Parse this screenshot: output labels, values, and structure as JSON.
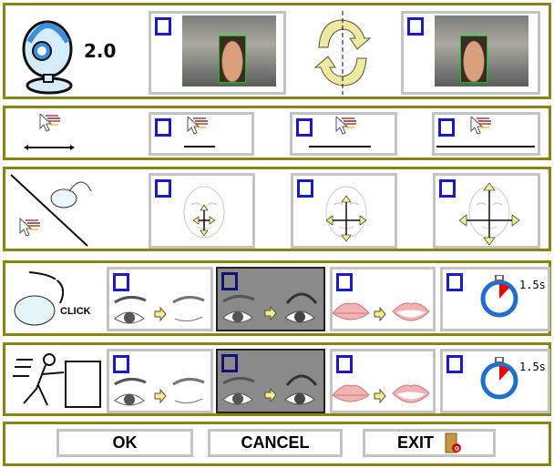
{
  "header": {
    "version": "2.0"
  },
  "camera_row": {
    "options": [
      {
        "name": "normal",
        "checked": false
      },
      {
        "name": "mirrored",
        "checked": false
      }
    ]
  },
  "speed_row": {
    "options": [
      {
        "name": "slow",
        "checked": false
      },
      {
        "name": "medium",
        "checked": false
      },
      {
        "name": "fast",
        "checked": false
      }
    ]
  },
  "movement_row": {
    "options": [
      {
        "name": "small",
        "checked": false
      },
      {
        "name": "medium",
        "checked": false
      },
      {
        "name": "large",
        "checked": false
      }
    ]
  },
  "click_row": {
    "label": "CLICK",
    "options": [
      {
        "name": "wink",
        "checked": false
      },
      {
        "name": "eyebrows",
        "checked": false,
        "selected": true
      },
      {
        "name": "mouth",
        "checked": false
      },
      {
        "name": "dwell",
        "checked": false,
        "time": "1.5s"
      }
    ]
  },
  "drag_row": {
    "options": [
      {
        "name": "wink",
        "checked": false
      },
      {
        "name": "eyebrows",
        "checked": false,
        "selected": true
      },
      {
        "name": "mouth",
        "checked": false
      },
      {
        "name": "dwell",
        "checked": false,
        "time": "1.5s"
      }
    ]
  },
  "buttons": {
    "ok": "OK",
    "cancel": "CANCEL",
    "exit": "EXIT"
  },
  "colors": {
    "panel_border": "#8a8410",
    "checkbox": "#1a1acc",
    "selected_bg": "#8a8a8a"
  }
}
